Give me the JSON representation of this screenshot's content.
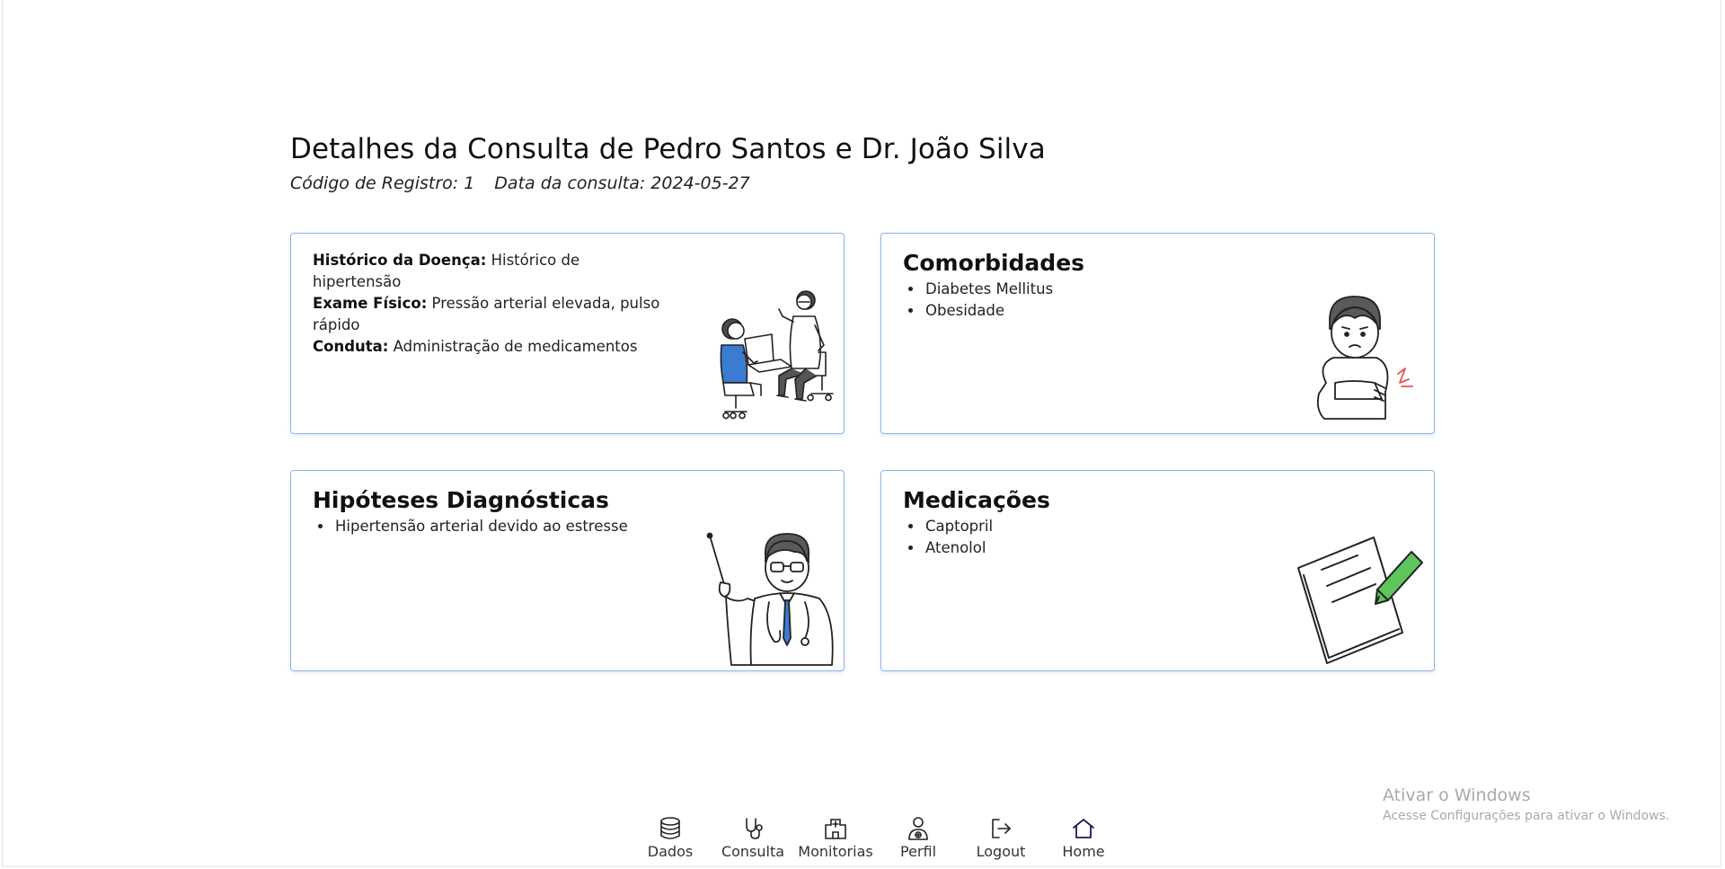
{
  "page": {
    "title": "Detalhes da Consulta de Pedro Santos e Dr. João Silva",
    "registro": "Código de Registro: 1",
    "data_consulta": "Data da consulta: 2024-05-27"
  },
  "cards": {
    "consulta": {
      "historico_label": "Histórico da Doença:",
      "historico_value": "Histórico de hipertensão",
      "exame_label": "Exame Físico:",
      "exame_value": "Pressão arterial elevada, pulso rápido",
      "conduta_label": "Conduta:",
      "conduta_value": "Administração de medicamentos",
      "illustration": "doctor-patient-illustration"
    },
    "comorbidades": {
      "title": "Comorbidades",
      "items": [
        "Diabetes Mellitus",
        "Obesidade"
      ],
      "illustration": "patient-pain-illustration"
    },
    "hipoteses": {
      "title": "Hipóteses Diagnósticas",
      "items": [
        "Hipertensão arterial devido ao estresse"
      ],
      "illustration": "doctor-pointer-illustration"
    },
    "medicacoes": {
      "title": "Medicações",
      "items": [
        "Captopril",
        "Atenolol"
      ],
      "illustration": "prescription-pencil-illustration"
    }
  },
  "nav": [
    {
      "label": "Dados",
      "icon": "database-icon"
    },
    {
      "label": "Consulta",
      "icon": "stethoscope-icon"
    },
    {
      "label": "Monitorias",
      "icon": "hospital-icon"
    },
    {
      "label": "Perfil",
      "icon": "doctor-icon"
    },
    {
      "label": "Logout",
      "icon": "logout-icon"
    },
    {
      "label": "Home",
      "icon": "home-icon"
    }
  ],
  "watermark": {
    "line1": "Ativar o Windows",
    "line2": "Acesse Configurações para ativar o Windows."
  },
  "colors": {
    "card_border": "#8ab4e8",
    "nav_icon_active": "#1a1a5e",
    "pencil": "#5cc65c",
    "pain_mark": "#e5554f",
    "tie": "#3b7bd1"
  }
}
